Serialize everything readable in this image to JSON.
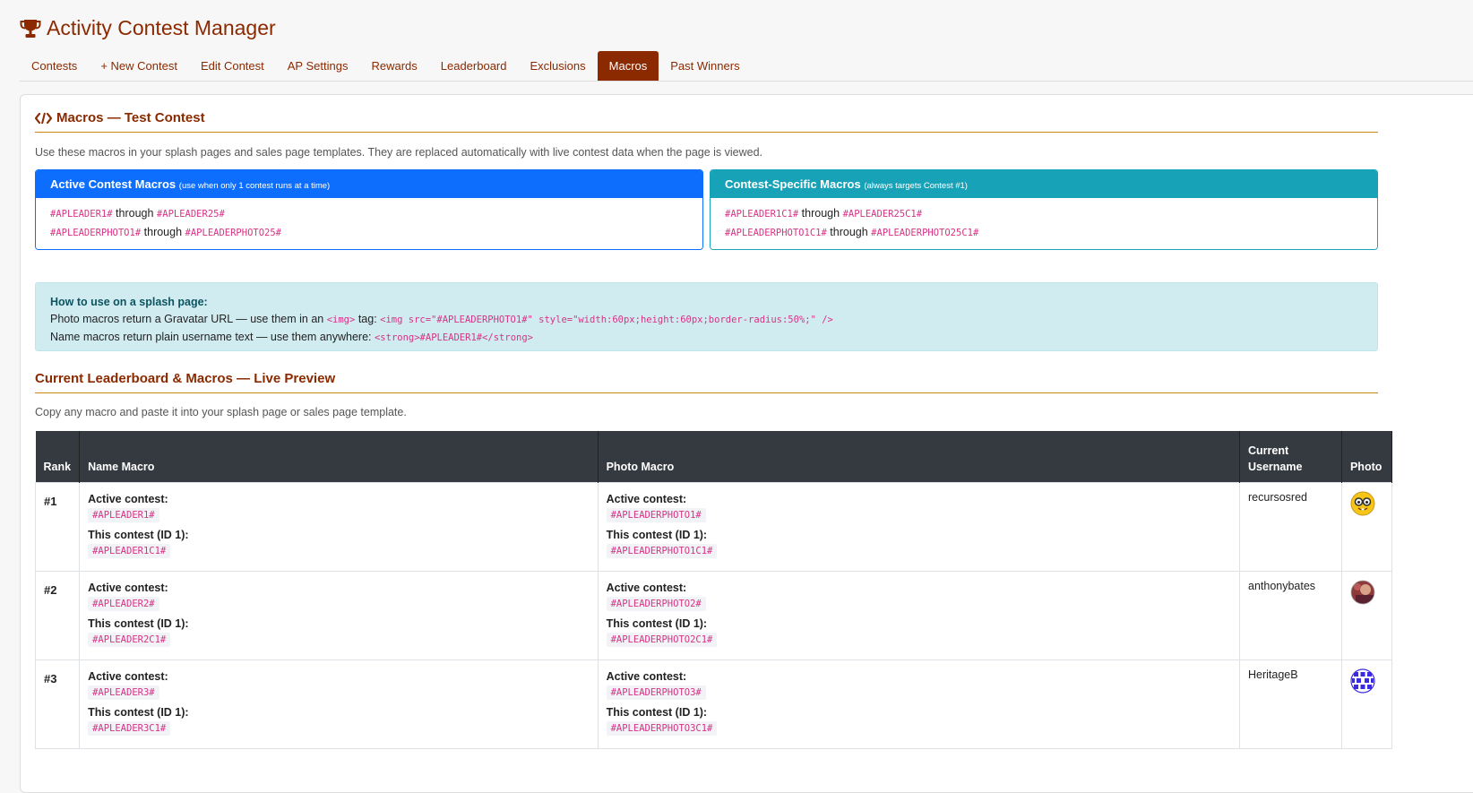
{
  "app": {
    "title": "Activity Contest Manager"
  },
  "tabs": [
    {
      "label": "Contests"
    },
    {
      "label": "+ New Contest"
    },
    {
      "label": "Edit Contest"
    },
    {
      "label": "AP Settings"
    },
    {
      "label": "Rewards"
    },
    {
      "label": "Leaderboard"
    },
    {
      "label": "Exclusions"
    },
    {
      "label": "Macros",
      "active": true
    },
    {
      "label": "Past Winners"
    }
  ],
  "macros": {
    "title": "Macros — Test Contest",
    "description": "Use these macros in your splash pages and sales page templates. They are replaced automatically with live contest data when the page is viewed.",
    "active_box": {
      "title": "Active Contest Macros",
      "subtitle": "(use when only 1 contest runs at a time)",
      "line1": {
        "from": "#APLEADER1#",
        "through": "through",
        "to": "#APLEADER25#"
      },
      "line2": {
        "from": "#APLEADERPHOTO1#",
        "through": "through",
        "to": "#APLEADERPHOTO25#"
      }
    },
    "specific_box": {
      "title": "Contest-Specific Macros",
      "subtitle": "(always targets Contest #1)",
      "line1": {
        "from": "#APLEADER1C1#",
        "through": "through",
        "to": "#APLEADER25C1#"
      },
      "line2": {
        "from": "#APLEADERPHOTO1C1#",
        "through": "through",
        "to": "#APLEADERPHOTO25C1#"
      }
    },
    "howto": {
      "label": "How to use on a splash page:",
      "line1_text_a": "Photo macros return a Gravatar URL — use them in an",
      "line1_code_a": "<img>",
      "line1_text_b": "tag:",
      "line1_code_b": "<img src=\"#APLEADERPHOTO1#\" style=\"width:60px;height:60px;border-radius:50%;\" />",
      "line2_text": "Name macros return plain username text — use them anywhere:",
      "line2_code": "<strong>#APLEADER1#</strong>"
    }
  },
  "leaderboard": {
    "title": "Current Leaderboard & Macros — Live Preview",
    "description": "Copy any macro and paste it into your splash page or sales page template.",
    "headers": {
      "rank": "Rank",
      "name_macro": "Name Macro",
      "photo_macro": "Photo Macro",
      "username_line1": "Current",
      "username_line2": "Username",
      "photo": "Photo"
    },
    "labels": {
      "active": "Active contest:",
      "this": "This contest (ID 1):"
    },
    "rows": [
      {
        "rank": "#1",
        "name_active": "#APLEADER1#",
        "name_this": "#APLEADER1C1#",
        "photo_active": "#APLEADERPHOTO1#",
        "photo_this": "#APLEADERPHOTO1C1#",
        "username": "recursosred",
        "avatar_icon": "nerd-face-avatar-icon"
      },
      {
        "rank": "#2",
        "name_active": "#APLEADER2#",
        "name_this": "#APLEADER2C1#",
        "photo_active": "#APLEADERPHOTO2#",
        "photo_this": "#APLEADERPHOTO2C1#",
        "username": "anthonybates",
        "avatar_icon": "photo-avatar-icon"
      },
      {
        "rank": "#3",
        "name_active": "#APLEADER3#",
        "name_this": "#APLEADER3C1#",
        "photo_active": "#APLEADERPHOTO3#",
        "photo_this": "#APLEADERPHOTO3C1#",
        "username": "HeritageB",
        "avatar_icon": "identicon-avatar-icon"
      }
    ]
  },
  "colors": {
    "brand": "#8b2a00",
    "active_box": "#0d6efd",
    "specific_box": "#17a2b8",
    "macro_text": "#d63384",
    "info_bg": "#d1ecf1",
    "table_header": "#343a40"
  }
}
